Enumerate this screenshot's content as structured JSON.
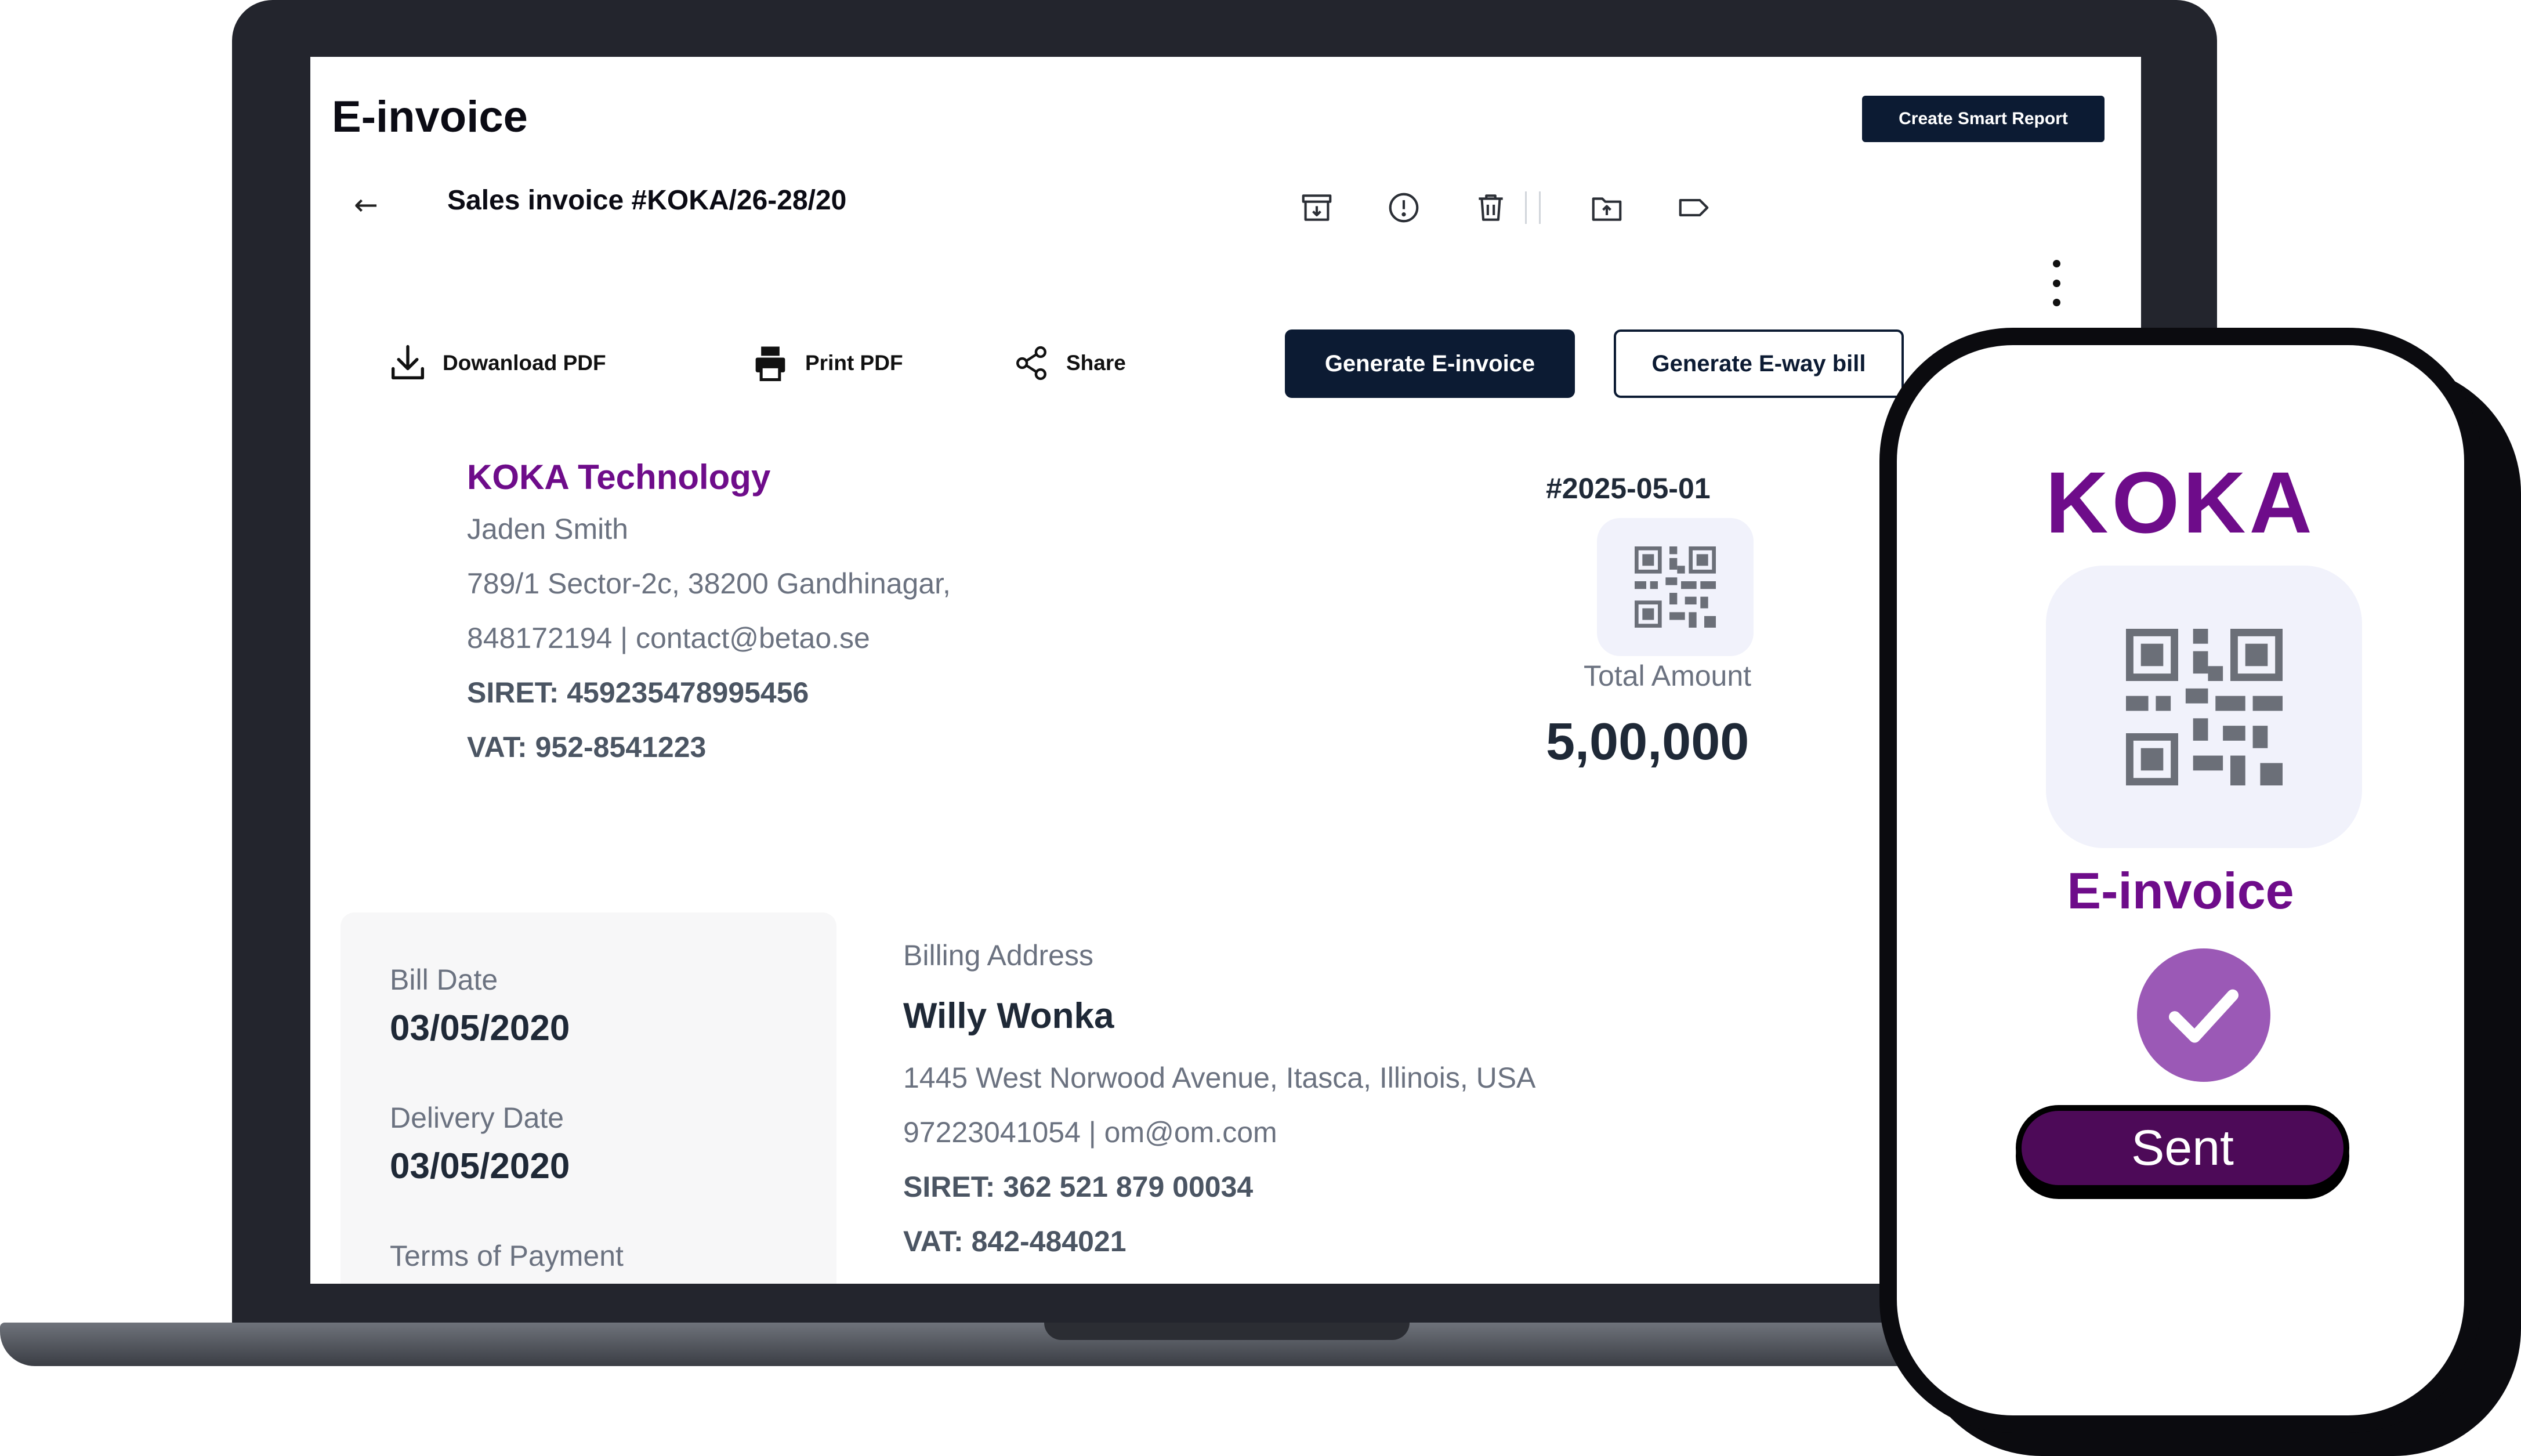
{
  "app": {
    "title": "E-invoice",
    "smart_report_label": "Create Smart Report"
  },
  "invoice": {
    "title": "Sales invoice #KOKA/26-28/20"
  },
  "toolbar_icons": [
    "archive-icon",
    "alert-icon",
    "trash-icon",
    "upload-folder-icon",
    "tag-icon"
  ],
  "actions": {
    "download_label": "Dowanload PDF",
    "print_label": "Print PDF",
    "share_label": "Share",
    "generate_einvoice_label": "Generate E-invoice",
    "generate_eway_label": "Generate E-way bill"
  },
  "company": {
    "name": "KOKA Technology",
    "contact": "Jaden Smith",
    "address": "789/1 Sector-2c, 38200 Gandhinagar,",
    "phone_email": "848172194 | contact@betao.se",
    "siret": "SIRET: 459235478995456",
    "vat": "VAT: 952-8541223"
  },
  "summary": {
    "invoice_number": "#2025-05-01",
    "total_label": "Total Amount",
    "total_value": "5,00,000"
  },
  "dates": {
    "bill_label": "Bill Date",
    "bill_value": "03/05/2020",
    "delivery_label": "Delivery Date",
    "delivery_value": "03/05/2020",
    "terms_label": "Terms of Payment"
  },
  "billing": {
    "label": "Billing Address",
    "name": "Willy Wonka",
    "address": "1445 West Norwood Avenue, Itasca, Illinois, USA",
    "phone_email": "97223041054 | om@om.com",
    "siret": "SIRET: 362 521 879 00034",
    "vat": "VAT: 842-484021"
  },
  "phone": {
    "logo": "KOKA",
    "label": "E-invoice",
    "status": "Sent"
  },
  "colors": {
    "brand_purple": "#6e0c8a",
    "navy": "#0c1b33",
    "check_purple": "#9b59b6",
    "sent_purple": "#4d0a58"
  }
}
